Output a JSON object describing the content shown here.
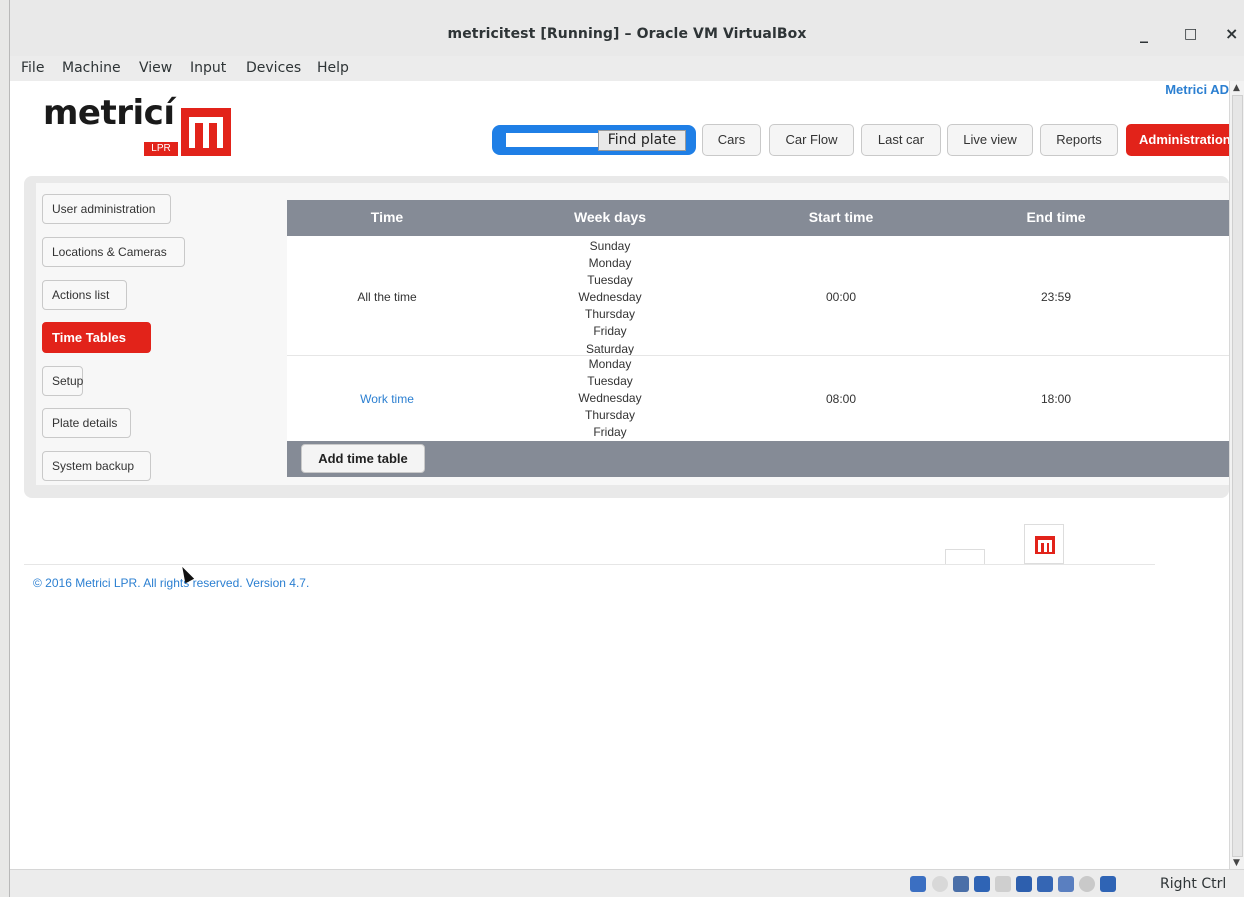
{
  "window": {
    "title": "metricitest [Running] – Oracle VM VirtualBox",
    "controls": {
      "minimize": "_",
      "maximize": "□",
      "close": "×"
    }
  },
  "menu": [
    "File",
    "Machine",
    "View",
    "Input",
    "Devices",
    "Help"
  ],
  "app": {
    "logo_word": "metricí",
    "logo_badge": "LPR",
    "user_link": "Metrici AD",
    "search": {
      "placeholder": "",
      "button": "Find plate"
    },
    "nav": [
      "Cars",
      "Car Flow",
      "Last car",
      "Live view",
      "Reports",
      "Administration"
    ],
    "nav_active": "Administration",
    "sidebar": [
      "User administration",
      "Locations & Cameras",
      "Actions list",
      "Time Tables",
      "Setup",
      "Plate details",
      "System backup"
    ],
    "sidebar_active": "Time Tables",
    "table": {
      "columns": [
        "Time",
        "Week days",
        "Start time",
        "End time"
      ],
      "rows": [
        {
          "time": "All the time",
          "days": [
            "Sunday",
            "Monday",
            "Tuesday",
            "Wednesday",
            "Thursday",
            "Friday",
            "Saturday"
          ],
          "start": "00:00",
          "end": "23:59"
        },
        {
          "time": "Work time",
          "days": [
            "Monday",
            "Tuesday",
            "Wednesday",
            "Thursday",
            "Friday"
          ],
          "start": "08:00",
          "end": "18:00"
        }
      ],
      "add_button": "Add time table"
    },
    "copyright": "© 2016 Metrici LPR. All rights reserved. Version 4.7."
  },
  "statusbar": {
    "host_key": "Right Ctrl"
  },
  "colors": {
    "accent_red": "#e2231a",
    "link_blue": "#2b7fd1",
    "header_gray": "#858b96",
    "search_blue": "#1f7fe6"
  }
}
